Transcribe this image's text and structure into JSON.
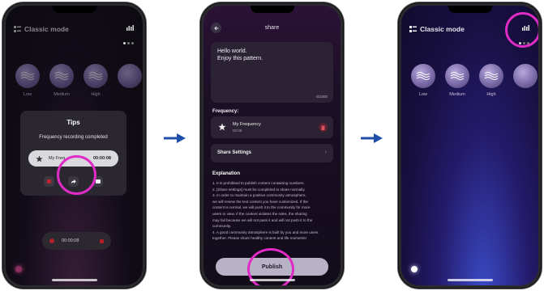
{
  "colors": {
    "highlight_ring": "#e12bc6",
    "arrow": "#1f4fa8",
    "publish_button": "#b7b2c6",
    "record_red": "#b0202a"
  },
  "icons": [
    "menu-icon",
    "spectrum-icon",
    "wave-icon",
    "star-icon",
    "share-icon",
    "stop-icon",
    "save-icon",
    "back-arrow-icon",
    "delete-icon",
    "chevron-right-icon"
  ],
  "phone1": {
    "mode_title": "Classic mode",
    "sounds": [
      {
        "label": "Low"
      },
      {
        "label": "Medium"
      },
      {
        "label": "High"
      }
    ],
    "tips": {
      "title": "Tips",
      "message": "Frequency recording completed",
      "item_name": "My Freq",
      "item_time": "00:00:08"
    },
    "recording_time": "00:00:08"
  },
  "phone2": {
    "title": "share",
    "text_line1": "Hello world.",
    "text_line2": "Enjoy this pattern.",
    "char_count": "5/1000",
    "frequency_label": "Frequency:",
    "frequency_name": "My Frequency",
    "frequency_duration": "00:08",
    "share_settings": "Share Settings",
    "explanation_title": "Explanation",
    "explanation_lines": [
      "1. It is prohibited to publish content containing numbers.",
      "2. [Share settings] must be completed to share normally.",
      "3. In order to maintain a positive community atmosphere,",
      "we will review the text content you have customized. If the",
      "content is normal, we will push it to the community for more",
      "users to view. If the content violates the rules, the sharing",
      "may fail because we will not pass it and will not push it to the",
      "community.",
      "4. A good community atmosphere is built by you and more users",
      "together. Please share healthy content and life moments!"
    ],
    "publish_label": "Publish"
  },
  "phone3": {
    "mode_title": "Classic mode",
    "sounds": [
      {
        "label": "Low"
      },
      {
        "label": "Medium"
      },
      {
        "label": "High"
      }
    ]
  }
}
